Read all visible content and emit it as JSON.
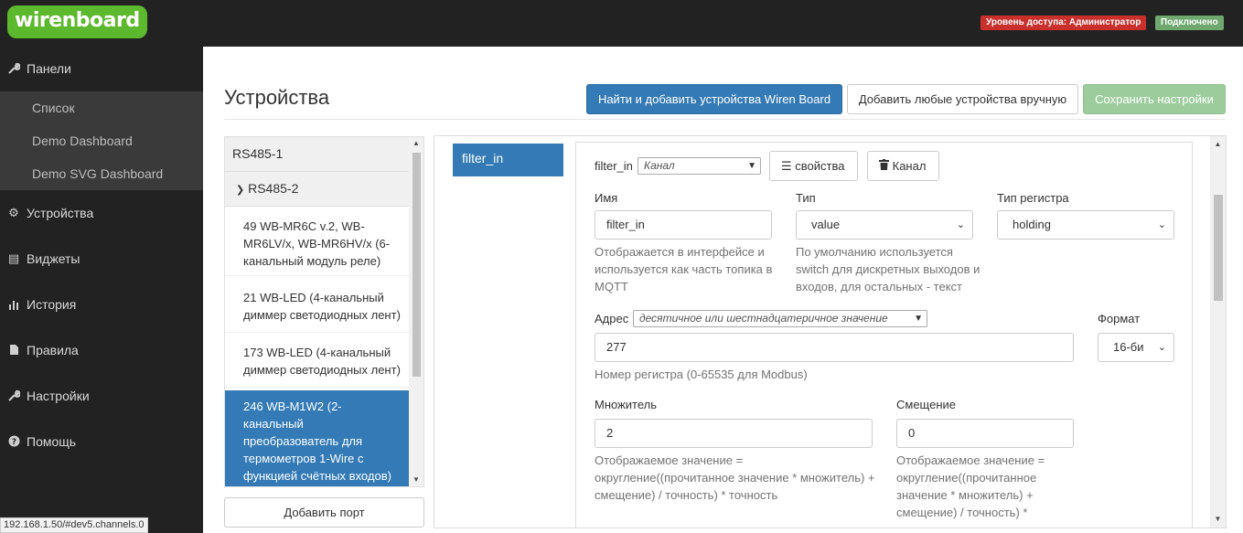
{
  "header": {
    "logo": "wirenboard",
    "access_badge": "Уровень доступа: Администратор",
    "connection_badge": "Подключено"
  },
  "sidebar": {
    "items": [
      {
        "label": "Панели",
        "icon": "wrench-icon"
      },
      {
        "label": "Устройства",
        "icon": "gear-icon"
      },
      {
        "label": "Виджеты",
        "icon": "list-icon"
      },
      {
        "label": "История",
        "icon": "bar-chart-icon"
      },
      {
        "label": "Правила",
        "icon": "file-icon"
      },
      {
        "label": "Настройки",
        "icon": "wrench-icon"
      },
      {
        "label": "Помощь",
        "icon": "question-icon"
      }
    ],
    "subitems": [
      "Список",
      "Demo Dashboard",
      "Demo SVG Dashboard"
    ]
  },
  "status_url": "192.168.1.50/#dev5.channels.0",
  "main": {
    "title": "Устройства",
    "btn_find": "Найти и добавить устройства Wiren Board",
    "btn_add_manual": "Добавить любые устройства вручную",
    "btn_save": "Сохранить настройки"
  },
  "ports": {
    "port1": "RS485-1",
    "port2": "RS485-2",
    "devices": [
      "49 WB-MR6C v.2, WB-MR6LV/x, WB-MR6HV/x (6-канальный модуль реле)",
      "21 WB-LED (4-канальный диммер светодиодных лент)",
      "173 WB-LED (4-канальный диммер светодиодных лент)",
      "246 WB-M1W2 (2-канальный преобразователь для термометров 1-Wire с функцией счётных входов)"
    ],
    "add_port": "Добавить порт"
  },
  "editor": {
    "channel_tab": "filter_in",
    "channel_name": "filter_in",
    "channel_select": "Канал",
    "btn_props": "свойства",
    "btn_channel": "Канал",
    "name_label": "Имя",
    "name_value": "filter_in",
    "name_help": "Отображается в интерфейсе и используется как часть топика в MQTT",
    "type_label": "Тип",
    "type_value": "value",
    "type_help": "По умолчанию используется switch для дискретных выходов и входов, для остальных - текст",
    "regtype_label": "Тип регистра",
    "regtype_value": "holding",
    "address_label": "Адрес",
    "address_select": "десятичное или шестнадцатеричное значение",
    "address_value": "277",
    "address_help": "Номер регистра (0-65535 для Modbus)",
    "format_label": "Формат",
    "format_value": "16-би",
    "scale_label": "Множитель",
    "scale_value": "2",
    "scale_help": "Отображаемое значение = округление((прочитанное значение * множитель) + смещение) / точность) * точность",
    "offset_label": "Смещение",
    "offset_value": "0",
    "offset_help": "Отображаемое значение = округление((прочитанное значение * множитель) + смещение) / точность) * точность"
  }
}
